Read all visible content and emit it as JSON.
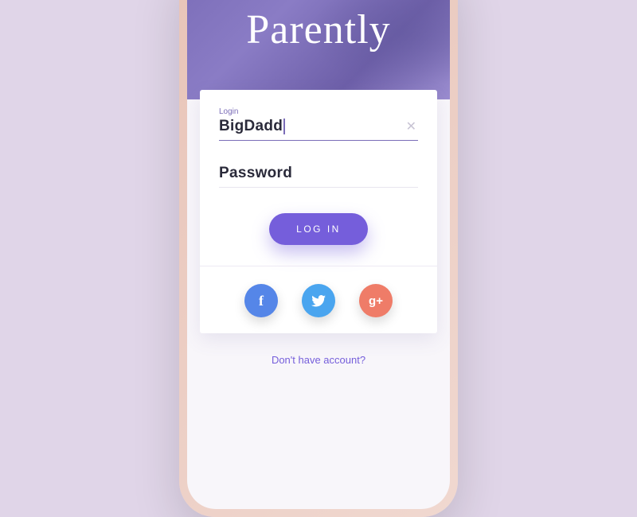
{
  "app": {
    "title": "Parently"
  },
  "login_form": {
    "login": {
      "label": "Login",
      "value": "BigDadd"
    },
    "password": {
      "placeholder": "Password"
    },
    "submit": "LOG IN"
  },
  "social": {
    "facebook": "f",
    "twitter": "twitter",
    "google": "g+"
  },
  "signup": {
    "prompt": "Don't have account?"
  }
}
